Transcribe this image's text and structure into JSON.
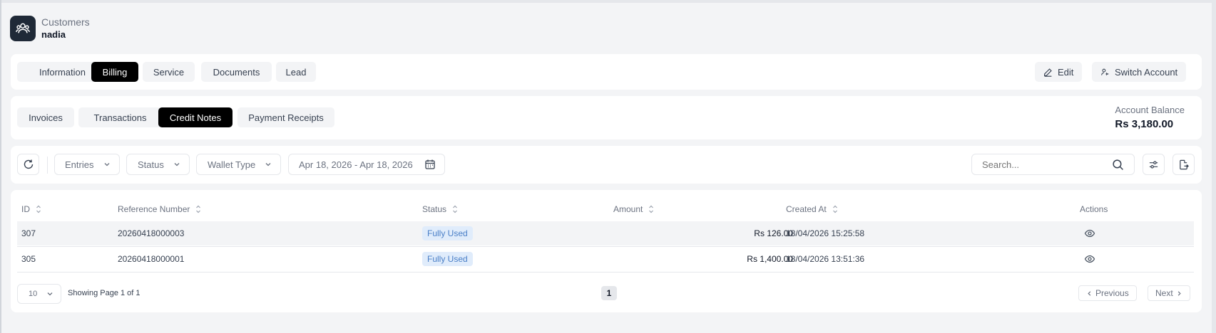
{
  "header": {
    "breadcrumb": "Customers",
    "customer_name": "nadia",
    "icon": "users-icon"
  },
  "primary_tabs": [
    {
      "label": "Information",
      "active": false
    },
    {
      "label": "Billing",
      "active": true
    },
    {
      "label": "Service",
      "active": false
    },
    {
      "label": "Documents",
      "active": false
    },
    {
      "label": "Lead",
      "active": false
    }
  ],
  "actions": {
    "edit_label": "Edit",
    "switch_account_label": "Switch Account"
  },
  "sub_tabs": [
    {
      "label": "Invoices",
      "active": false
    },
    {
      "label": "Transactions",
      "active": false
    },
    {
      "label": "Credit Notes",
      "active": true
    },
    {
      "label": "Payment Receipts",
      "active": false
    }
  ],
  "account_balance": {
    "label": "Account Balance",
    "value": "Rs 3,180.00"
  },
  "filters": {
    "entries_label": "Entries",
    "status_label": "Status",
    "wallet_type_label": "Wallet Type",
    "date_range": "Apr 18, 2026 - Apr 18, 2026",
    "search_placeholder": "Search..."
  },
  "table": {
    "columns": [
      "ID",
      "Reference Number",
      "Status",
      "Amount",
      "Created At",
      "Actions"
    ],
    "rows": [
      {
        "id": "307",
        "reference": "20260418000003",
        "status": "Fully Used",
        "amount": "Rs 126.00",
        "created_at": "18/04/2026 15:25:58"
      },
      {
        "id": "305",
        "reference": "20260418000001",
        "status": "Fully Used",
        "amount": "Rs 1,400.00",
        "created_at": "18/04/2026 13:51:36"
      }
    ]
  },
  "pagination": {
    "page_size": "10",
    "showing_text": "Showing Page 1 of 1",
    "current_page": "1",
    "previous_label": "Previous",
    "next_label": "Next"
  },
  "colors": {
    "active_tab": "#000000",
    "badge_bg": "#e0ecfb",
    "badge_text": "#4a7fc7"
  }
}
